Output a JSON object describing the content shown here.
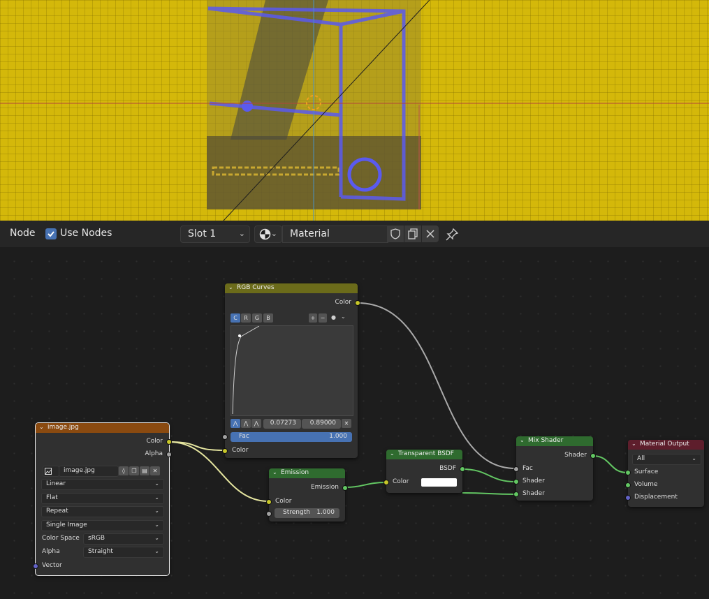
{
  "header": {
    "editor_type": "Node",
    "use_nodes_label": "Use Nodes",
    "use_nodes_checked": true,
    "slot": "Slot 1",
    "material_name": "Material"
  },
  "nodes": {
    "rgb_curves": {
      "title": "RGB Curves",
      "output_color": "Color",
      "channels": [
        "C",
        "R",
        "G",
        "B"
      ],
      "point_x": "0.07273",
      "point_y": "0.89000",
      "fac_label": "Fac",
      "fac_value": "1.000",
      "input_color": "Color"
    },
    "image": {
      "title": "image.jpg",
      "output_color": "Color",
      "output_alpha": "Alpha",
      "image_name": "image.jpg",
      "interpolation": "Linear",
      "projection": "Flat",
      "extension": "Repeat",
      "source": "Single Image",
      "color_space_label": "Color Space",
      "color_space": "sRGB",
      "alpha_label": "Alpha",
      "alpha_mode": "Straight",
      "input_vector": "Vector"
    },
    "emission": {
      "title": "Emission",
      "output": "Emission",
      "input_color": "Color",
      "strength_label": "Strength",
      "strength_value": "1.000"
    },
    "transparent": {
      "title": "Transparent BSDF",
      "output": "BSDF",
      "input_color": "Color",
      "color_value": "#ffffff"
    },
    "mix_shader": {
      "title": "Mix Shader",
      "output": "Shader",
      "input_fac": "Fac",
      "input_shader1": "Shader",
      "input_shader2": "Shader"
    },
    "material_output": {
      "title": "Material Output",
      "target": "All",
      "input_surface": "Surface",
      "input_volume": "Volume",
      "input_displacement": "Displacement"
    }
  },
  "colors": {
    "viewport_background": "#d4b80a",
    "texture_header_color": "#c7c729",
    "shader_header_color": "#2f6b2f",
    "output_header_color": "#5e1e2c",
    "input_header_color": "#8a4a10",
    "accent": "#4772b3"
  },
  "icons": [
    "checkbox-icon",
    "material-sphere-icon",
    "shield-icon",
    "duplicate-icon",
    "close-icon",
    "pin-icon"
  ]
}
